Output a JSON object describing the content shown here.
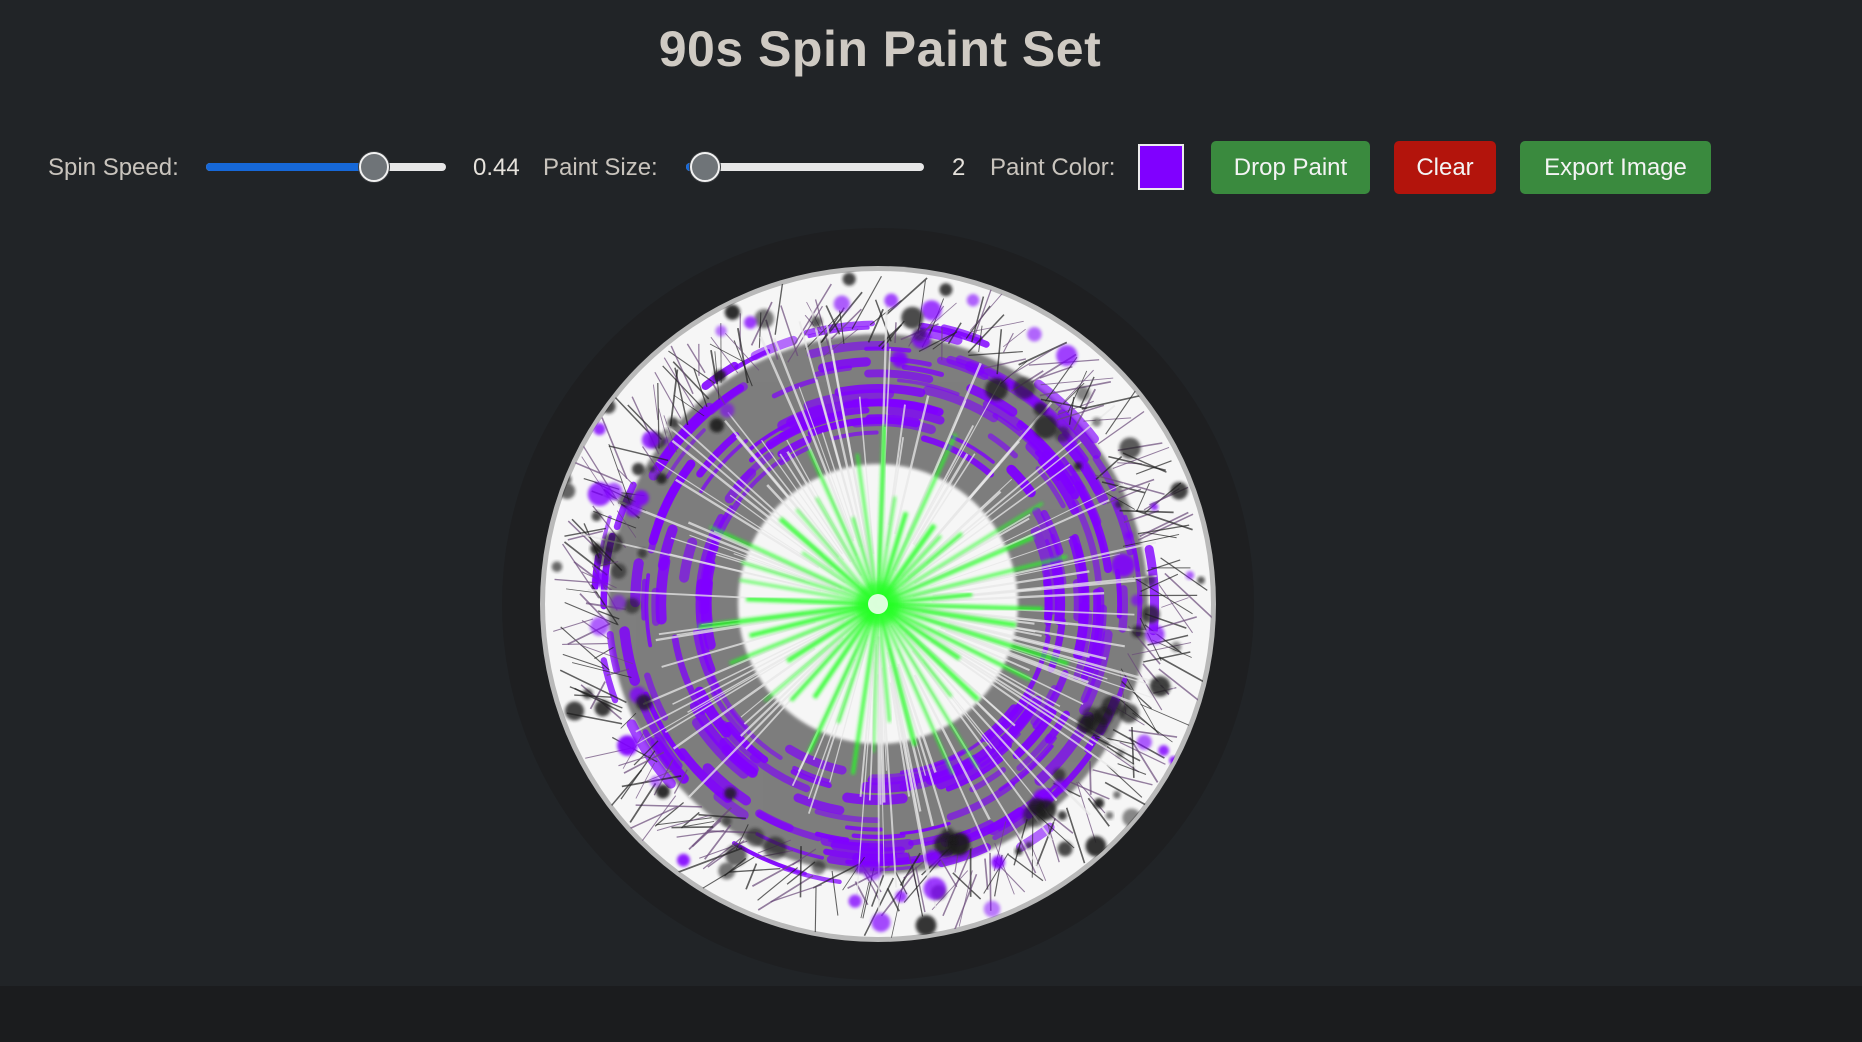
{
  "title": "90s Spin Paint Set",
  "controls": {
    "spin_speed_label": "Spin Speed:",
    "spin_speed_value": "0.44",
    "spin_speed_fraction": 0.7,
    "paint_size_label": "Paint Size:",
    "paint_size_value": "2",
    "paint_size_fraction": 0.08,
    "paint_color_label": "Paint Color:",
    "paint_color": "#8000ff",
    "drop_paint_label": "Drop Paint",
    "clear_label": "Clear",
    "export_label": "Export Image"
  },
  "colors": {
    "background": "#212427",
    "title": "#cfcac3",
    "slider_fill": "#1668d8",
    "button_green": "#3a8a3e",
    "button_red": "#b3140c",
    "paint_primary": "#8000ff",
    "paint_secondary": "#22ff22",
    "paint_dark": "#1a1a1a",
    "canvas_white": "#f5f5f5"
  }
}
